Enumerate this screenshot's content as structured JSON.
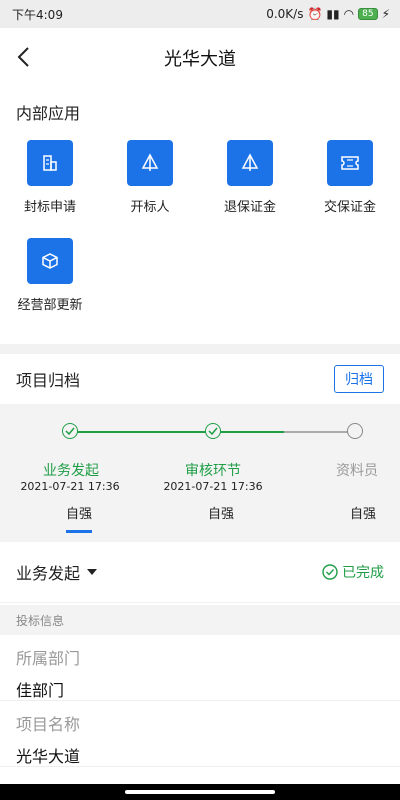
{
  "status": {
    "time": "下午4:09",
    "speed": "0.0K/s",
    "battery": "85"
  },
  "nav": {
    "title": "光华大道"
  },
  "internal_apps": {
    "title": "内部应用",
    "items": [
      {
        "label": "封标申请",
        "icon": "building-icon"
      },
      {
        "label": "开标人",
        "icon": "tent-icon"
      },
      {
        "label": "退保证金",
        "icon": "tent-icon"
      },
      {
        "label": "交保证金",
        "icon": "ticket-icon"
      },
      {
        "label": "经营部更新",
        "icon": "cube-icon"
      }
    ]
  },
  "archive": {
    "title": "项目归档",
    "button": "归档"
  },
  "steps": [
    {
      "name": "业务发起",
      "time": "2021-07-21 17:36",
      "person": "自强",
      "status": "done"
    },
    {
      "name": "审核环节",
      "time": "2021-07-21 17:36",
      "person": "自强",
      "status": "done"
    },
    {
      "name": "资料员",
      "time": "",
      "person": "自强",
      "status": "pending"
    }
  ],
  "biz": {
    "label": "业务发起",
    "status": "已完成"
  },
  "bid_info": {
    "title": "投标信息",
    "fields": [
      {
        "label": "所属部门",
        "value": "佳部门"
      },
      {
        "label": "项目名称",
        "value": "光华大道"
      }
    ]
  },
  "colors": {
    "accent": "#1c73e8",
    "success": "#1f9e46"
  }
}
